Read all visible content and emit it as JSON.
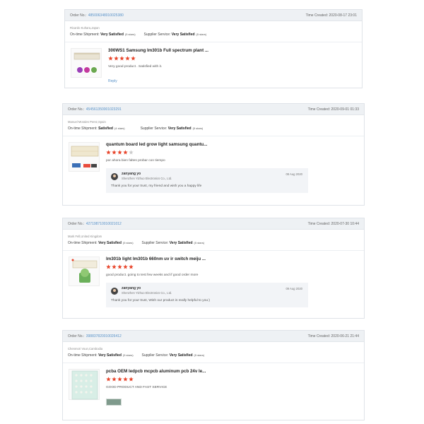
{
  "labels": {
    "order_no": "Order No.:",
    "time_created": "Time Created:",
    "on_time_shipment": "On-time Shipment:",
    "supplier_service": "Supplier Service:",
    "reply": "Reply"
  },
  "orders": [
    {
      "order_no": "485006348010025380",
      "time_created": "2020-08-17 23:01",
      "buyer": "Ricardo Kuhara,Japan",
      "shipment_rating": "Very Satisfied",
      "shipment_stars": "(5 stars)",
      "service_rating": "Very Satisfied",
      "service_stars": "(5 stars)",
      "product_title": "300WS1 Samsung lm301b Full spectrum plant ...",
      "stars": 5,
      "comment": "Very good product . Satisfied with it.",
      "star_color": "#e8462c"
    },
    {
      "order_no": "454561350001023291",
      "time_created": "2020-09-01 01:33",
      "buyer": "Manuel Morales Perez,Spain",
      "shipment_rating": "Satisfied",
      "shipment_stars": "(4 stars)",
      "service_rating": "Very Satisfied",
      "service_stars": "(5 stars)",
      "product_title": "quantum board led grow light samsung quantu...",
      "stars": 4,
      "comment": "por ahora bien faltes probar con tiempo",
      "reply": {
        "name": "zanyang yo",
        "company": "Shenzhen Yizhuo Electronics Co., Ltd.",
        "date": "08 Aug 2020",
        "text": "Thank you for your trust, my friend and wish you a happy life"
      }
    },
    {
      "order_no": "427198710010021012",
      "time_created": "2020-07-30 10:44",
      "buyer": "Mark Fell,United Kingdom",
      "shipment_rating": "Very Satisfied",
      "shipment_stars": "(5 stars)",
      "service_rating": "Very Satisfied",
      "service_stars": "(5 stars)",
      "product_title": "lm301b light lm301b 660nm uv ir switch meiju ...",
      "stars": 5,
      "comment": "good product. going to test few weeks and if good order more",
      "reply": {
        "name": "zanyang yo",
        "company": "Shenzhen Yizhuo Electronics Co., Ltd.",
        "date": "09 Aug 2020",
        "text": "Thank you for your trust, Wish our product is really helpful to you:)"
      }
    },
    {
      "order_no": "398837820010026412",
      "time_created": "2020-06-21 21:44",
      "buyer": "Chenmori Voun,Cambodia",
      "shipment_rating": "Very Satisfied",
      "shipment_stars": "(5 stars)",
      "service_rating": "Very Satisfied",
      "service_stars": "(5 stars)",
      "product_title": "pcba OEM ledpcb mcpcb aluminum pcb 24v le...",
      "stars": 5,
      "comment": "GOOD PRODUCT AND FAST SERVICE"
    }
  ],
  "colors": {
    "star_filled": "#e8462c",
    "star_empty": "#cccccc",
    "link": "#5a93c9",
    "header_bg": "#eef1f4"
  }
}
